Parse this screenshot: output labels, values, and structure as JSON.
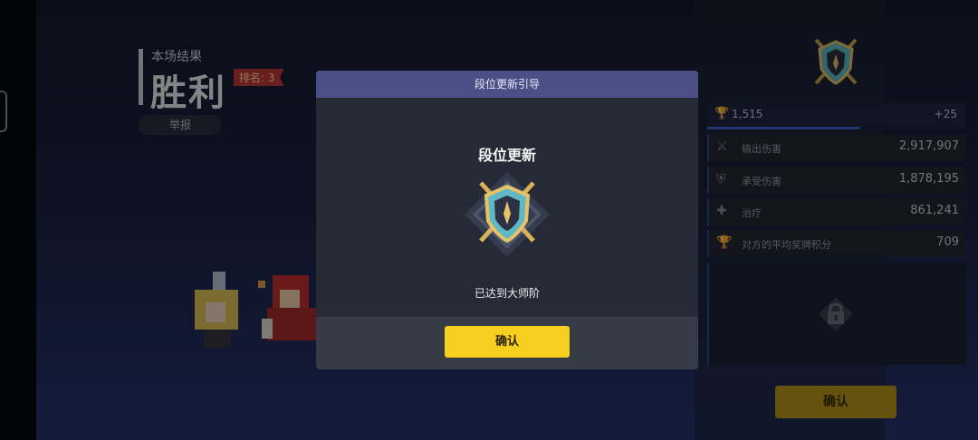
{
  "result": {
    "subtitle": "本场结果",
    "title": "胜利",
    "rank_label": "排名: 3",
    "report_label": "举报"
  },
  "stats": {
    "trophies": "1,515",
    "trophy_delta": "+25",
    "rows": [
      {
        "icon": "swords-icon",
        "label": "输出伤害",
        "value": "2,917,907"
      },
      {
        "icon": "shield-icon",
        "label": "承受伤害",
        "value": "1,878,195"
      },
      {
        "icon": "plus-icon",
        "label": "治疗",
        "value": "861,241"
      },
      {
        "icon": "trophy-icon",
        "label": "对方的平均奖牌积分",
        "value": "709"
      }
    ],
    "confirm_label": "确认"
  },
  "modal": {
    "header": "段位更新引导",
    "title": "段位更新",
    "message": "已达到大师阶",
    "confirm_label": "确认"
  },
  "colors": {
    "modal_header": "#4a4f86",
    "confirm_button": "#f7cf1e",
    "emblem_gold": "#d8b25a",
    "emblem_teal": "#5fb8c4"
  }
}
